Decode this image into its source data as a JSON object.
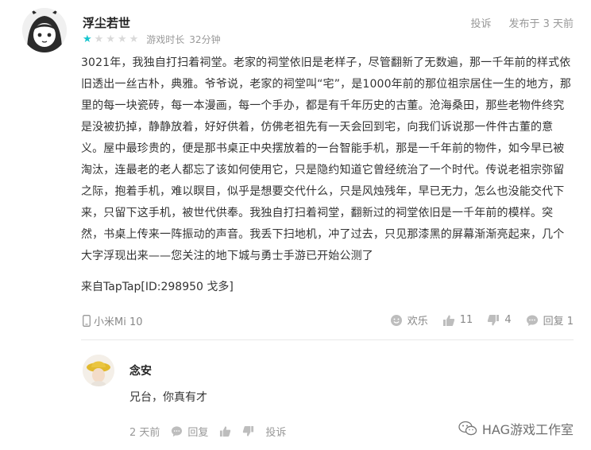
{
  "review": {
    "username": "浮尘若世",
    "report_label": "投诉",
    "published": "发布于 3 天前",
    "rating": 1,
    "max_rating": 5,
    "playtime_label": "游戏时长",
    "playtime_value": "32分钟",
    "body": "3021年，我独自打扫着祠堂。老家的祠堂依旧是老样子，尽管翻新了无数遍，那一千年前的样式依旧透出一丝古朴，典雅。爷爷说，老家的祠堂叫“宅”，是1000年前的那位祖宗居住一生的地方，那里的每一块瓷砖，每一本漫画，每一个手办，都是有千年历史的古董。沧海桑田，那些老物件终究是没被扔掉，静静放着，好好供着，仿佛老祖先有一天会回到宅，向我们诉说那一件件古董的意义。屋中最珍贵的，便是那书桌正中央摆放着的一台智能手机，那是一千年前的物件，如今早已被淘汰，连最老的老人都忘了该如何使用它，只是隐约知道它曾经统治了一个时代。传说老祖宗弥留之际，抱着手机，难以瞑目，似乎是想要交代什么，只是风烛残年，早已无力，怎么也没能交代下来，只留下这手机，被世代供奉。我独自打扫着祠堂，翻新过的祠堂依旧是一千年前的模样。突然，书桌上传来一阵振动的声音。我丢下扫地机，冲了过去，只见那漆黑的屏幕渐渐亮起来，几个大字浮现出来——您关注的地下城与勇士手游已开始公测了",
    "source": "来自TapTap[ID:298950 戈多]",
    "device": "小米Mi 10",
    "funny_label": "欢乐",
    "likes": "11",
    "dislikes": "4",
    "replies": "回复 1"
  },
  "reply": {
    "name": "念安",
    "text": "兄台，你真有才",
    "time": "2 天前",
    "reply_label": "回复",
    "report_label": "投诉"
  },
  "watermark": {
    "text": "HAG游戏工作室"
  },
  "colors": {
    "star_on": "#15c5ce",
    "star_off": "#d9d9d9",
    "muted": "#999999"
  }
}
